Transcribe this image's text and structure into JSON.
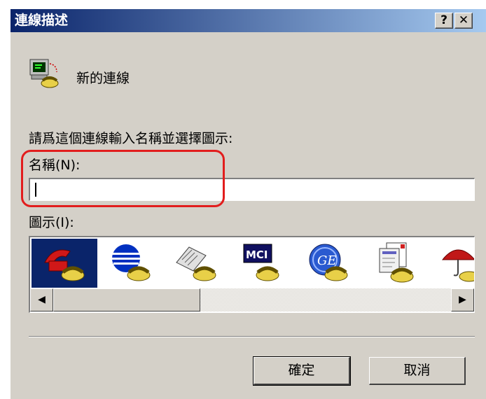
{
  "window": {
    "title": "連線描述",
    "help_label": "?",
    "close_label": "✕"
  },
  "connection": {
    "name": "新的連線",
    "icon": "phone-computer-icon"
  },
  "form": {
    "prompt": "請爲這個連線輸入名稱並選擇圖示:",
    "name_label": "名稱(N):",
    "name_value": "",
    "icon_label": "圖示(I):"
  },
  "icons": [
    {
      "name": "red-phone-icon",
      "selected": true
    },
    {
      "name": "globe-phone-icon",
      "selected": false
    },
    {
      "name": "fax-phone-icon",
      "selected": false
    },
    {
      "name": "mci-phone-icon",
      "selected": false,
      "text": "MCI"
    },
    {
      "name": "ge-phone-icon",
      "selected": false,
      "text": "GE"
    },
    {
      "name": "documents-phone-icon",
      "selected": false
    },
    {
      "name": "umbrella-phone-icon",
      "selected": false
    }
  ],
  "scrollbar": {
    "left_arrow": "◀",
    "right_arrow": "▶"
  },
  "buttons": {
    "ok": "確定",
    "cancel": "取消"
  },
  "colors": {
    "titlebar_start": "#0a246a",
    "titlebar_end": "#a6caf0",
    "highlight": "#e21d1d",
    "dialog_bg": "#d4d0c8"
  }
}
